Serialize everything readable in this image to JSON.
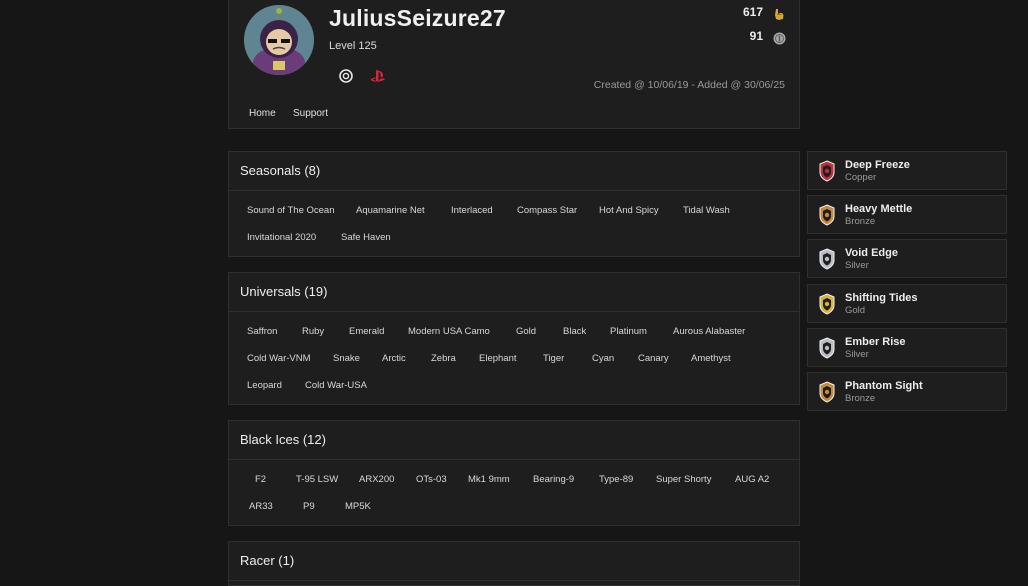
{
  "profile": {
    "username": "JuliusSeizure27",
    "level": "Level 125",
    "created": "Created @ 10/06/19 - Added @ 30/06/25",
    "stat_primary": "617",
    "stat_secondary": "91",
    "nav": [
      "Home",
      "Support"
    ]
  },
  "sections": [
    {
      "title": "Seasonals (8)",
      "rows": [
        [
          "Sound of The Ocean",
          "Aquamarine Net",
          "Interlaced",
          "Compass Star",
          "Hot And Spicy",
          "Tidal Wash"
        ],
        [
          "Invitational 2020",
          "Safe Haven"
        ]
      ]
    },
    {
      "title": "Universals (19)",
      "rows": [
        [
          "Saffron",
          "Ruby",
          "Emerald",
          "Modern USA Camo",
          "Gold",
          "Black",
          "Platinum",
          "Aurous Alabaster"
        ],
        [
          "Cold War-VNM",
          "Snake",
          "Arctic",
          "Zebra",
          "Elephant",
          "Tiger",
          "Cyan",
          "Canary",
          "Amethyst"
        ],
        [
          "Leopard",
          "Cold War-USA"
        ]
      ]
    },
    {
      "title": "Black Ices (12)",
      "rows": [
        [
          "F2",
          "T-95 LSW",
          "ARX200",
          "OTs-03",
          "Mk1 9mm",
          "Bearing-9",
          "Type-89",
          "Super Shorty",
          "AUG A2"
        ],
        [
          "AR33",
          "P9",
          "MP5K"
        ]
      ]
    },
    {
      "title": "Racer (1)",
      "rows": []
    }
  ],
  "ranks": [
    {
      "name": "Deep Freeze",
      "tier": "Copper",
      "color": "#b8323a"
    },
    {
      "name": "Heavy Mettle",
      "tier": "Bronze",
      "color": "#c58a3e"
    },
    {
      "name": "Void Edge",
      "tier": "Silver",
      "color": "#b9bec4"
    },
    {
      "name": "Shifting Tides",
      "tier": "Gold",
      "color": "#d8b23a"
    },
    {
      "name": "Ember Rise",
      "tier": "Silver",
      "color": "#b9bec4"
    },
    {
      "name": "Phantom Sight",
      "tier": "Bronze",
      "color": "#c58a3e"
    }
  ],
  "icons": {
    "platform_1": "ubisoft-icon",
    "platform_2": "playstation-icon",
    "stat_primary": "trophy-hand-icon",
    "stat_secondary": "coin-icon"
  }
}
